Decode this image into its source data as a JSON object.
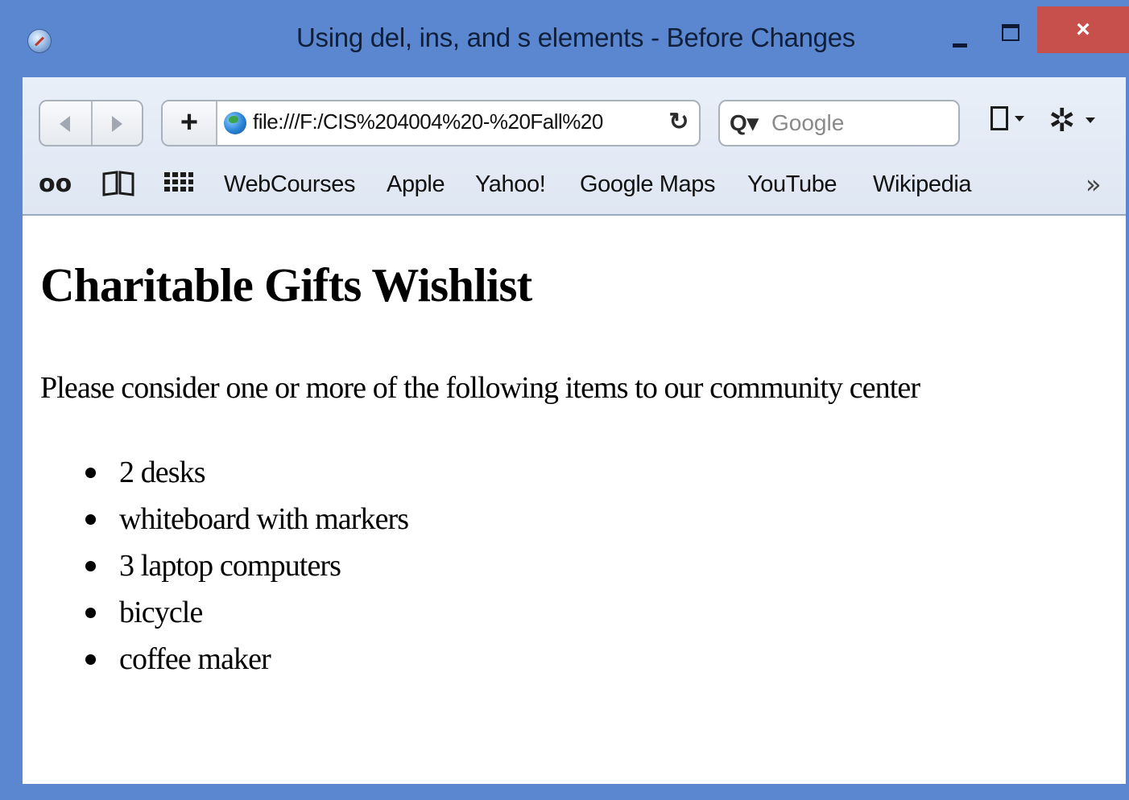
{
  "window": {
    "title": "Using del, ins, and s elements - Before Changes",
    "close_glyph": "×"
  },
  "toolbar": {
    "add_label": "+",
    "url": "file:///F:/CIS%204004%20-%20Fall%20",
    "reload_glyph": "↻",
    "search_icon_glyph": "Q▾",
    "search_placeholder": "Google",
    "gear_glyph": "✲"
  },
  "bookmarks": {
    "reading_list_glyph": "oo",
    "book_glyph": "📖",
    "grid_glyph": "▦",
    "links": [
      "WebCourses",
      "Apple",
      "Yahoo!",
      "Google Maps",
      "YouTube",
      "Wikipedia"
    ],
    "more_glyph": "»"
  },
  "page": {
    "heading": "Charitable Gifts Wishlist",
    "intro": "Please consider one or more of the following items to our community center",
    "items": [
      "2 desks",
      "whiteboard with markers",
      "3 laptop computers",
      "bicycle",
      "coffee maker"
    ]
  },
  "colors": {
    "titlebar": "#5b87d0",
    "close_button": "#c7504d"
  }
}
